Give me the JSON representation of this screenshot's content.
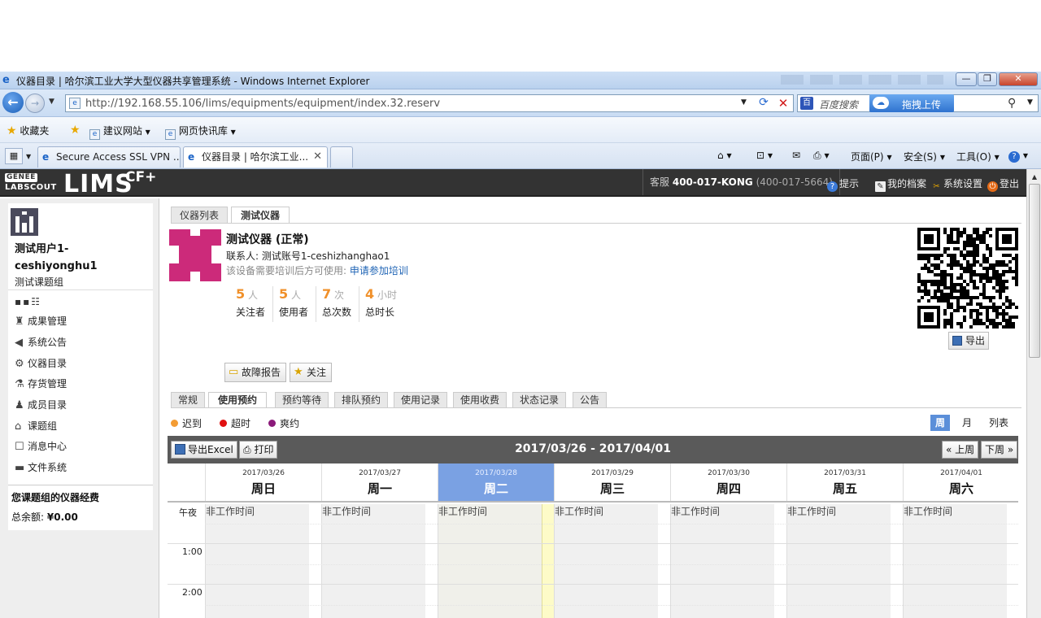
{
  "window": {
    "title": "仪器目录 | 哈尔滨工业大学大型仪器共享管理系统 - Windows Internet Explorer",
    "minimize": "—",
    "restore": "❐",
    "close": "✕"
  },
  "address": {
    "url": "http://192.168.55.106/lims/equipments/equipment/index.32.reserv",
    "search_engine": "百度搜索",
    "cloud_button": "拖拽上传"
  },
  "favorites": {
    "label": "收藏夹",
    "items": [
      "建议网站",
      "网页快讯库"
    ]
  },
  "tabs": [
    {
      "label": "Secure Access SSL VPN ..."
    },
    {
      "label": "仪器目录 | 哈尔滨工业..."
    }
  ],
  "commands": {
    "page": "页面(P)",
    "safety": "安全(S)",
    "tools": "工具(O)"
  },
  "header": {
    "brand_small_1": "GENEE",
    "brand_small_2": "LABSCOUT",
    "brand_big": "LIMS",
    "brand_sup": "CF+",
    "hotline_label": "客服",
    "hotline_code": "400-017-KONG",
    "hotline_number": "(400-017-5664)",
    "links": [
      "提示",
      "我的档案",
      "系统设置",
      "登出"
    ]
  },
  "sidebar": {
    "user_name_1": "测试用户1-",
    "user_name_2": "ceshiyonghu1",
    "user_group": "测试课题组",
    "menu": [
      "成果管理",
      "系统公告",
      "仪器目录",
      "存货管理",
      "成员目录",
      "课题组",
      "消息中心",
      "文件系统"
    ],
    "budget_title": "您课题组的仪器经费",
    "budget_label": "总余额:",
    "budget_value": "¥0.00"
  },
  "top_tabs": [
    "仪器列表",
    "测试仪器"
  ],
  "equipment": {
    "name": "测试仪器 (正常)",
    "contact": "联系人: 测试账号1-ceshizhanghao1",
    "training_text": "该设备需要培训后方可使用:",
    "training_link": "申请参加培训",
    "stats": [
      {
        "num": "5",
        "unit": "人",
        "label": "关注者"
      },
      {
        "num": "5",
        "unit": "人",
        "label": "使用者"
      },
      {
        "num": "7",
        "unit": "次",
        "label": "总次数"
      },
      {
        "num": "4",
        "unit": "小时",
        "label": "总时长"
      }
    ],
    "export": "导出",
    "report_button": "故障报告",
    "follow_button": "关注"
  },
  "sub_tabs": [
    "常规",
    "使用预约",
    "预约等待",
    "排队预约",
    "使用记录",
    "使用收费",
    "状态记录",
    "公告"
  ],
  "legend": [
    {
      "label": "迟到",
      "color": "#f39c34"
    },
    {
      "label": "超时",
      "color": "#e01010"
    },
    {
      "label": "爽约",
      "color": "#8b1a7a"
    }
  ],
  "views": [
    "周",
    "月",
    "列表"
  ],
  "calendar": {
    "export_excel": "导出Excel",
    "print": "打印",
    "range": "2017/03/26 - 2017/04/01",
    "prev_week": "« 上周",
    "next_week": "下周 »",
    "days": [
      {
        "date": "2017/03/26",
        "name": "周日"
      },
      {
        "date": "2017/03/27",
        "name": "周一"
      },
      {
        "date": "2017/03/28",
        "name": "周二"
      },
      {
        "date": "2017/03/29",
        "name": "周三"
      },
      {
        "date": "2017/03/30",
        "name": "周四"
      },
      {
        "date": "2017/03/31",
        "name": "周五"
      },
      {
        "date": "2017/04/01",
        "name": "周六"
      }
    ],
    "time_labels": [
      "午夜",
      "1:00",
      "2:00"
    ],
    "non_work": "非工作时间",
    "today_index": 2
  }
}
